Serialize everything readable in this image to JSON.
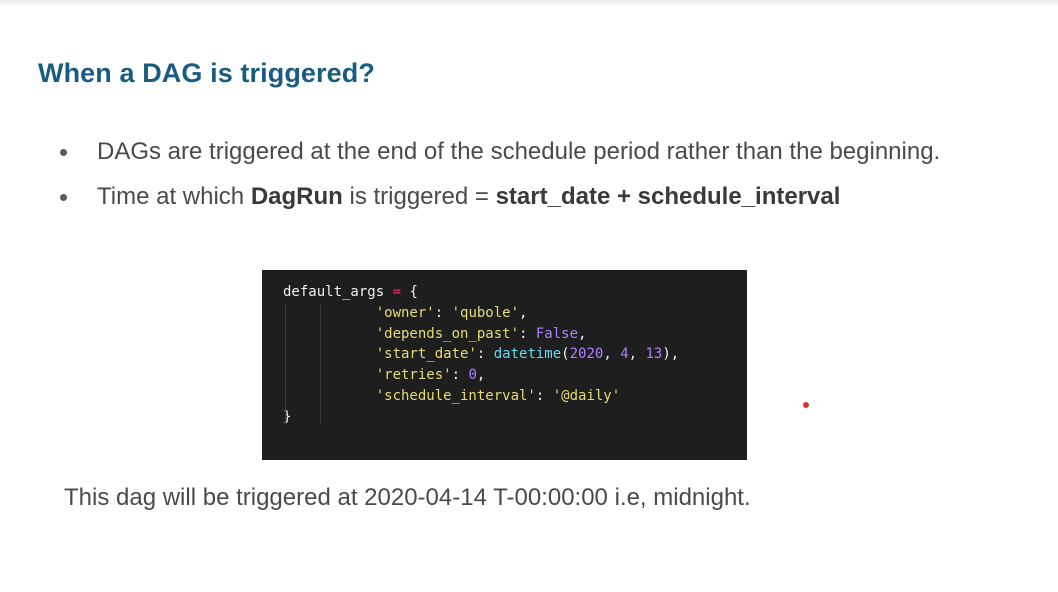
{
  "slide": {
    "title": "When a DAG is triggered?",
    "bullets": [
      {
        "text": "DAGs are triggered at the end of the schedule period rather than the beginning."
      },
      {
        "prefix": "Time at which ",
        "bold1": "DagRun",
        "middle": " is triggered = ",
        "bold2": "start_date + schedule_interval"
      }
    ],
    "code": {
      "lines": [
        [
          {
            "t": "default_args ",
            "c": "plain"
          },
          {
            "t": "=",
            "c": "op"
          },
          {
            "t": " {",
            "c": "plain"
          }
        ],
        [
          {
            "t": "           ",
            "c": "plain"
          },
          {
            "t": "'owner'",
            "c": "str"
          },
          {
            "t": ": ",
            "c": "plain"
          },
          {
            "t": "'qubole'",
            "c": "str"
          },
          {
            "t": ",",
            "c": "plain"
          }
        ],
        [
          {
            "t": "           ",
            "c": "plain"
          },
          {
            "t": "'depends_on_past'",
            "c": "str"
          },
          {
            "t": ": ",
            "c": "plain"
          },
          {
            "t": "False",
            "c": "bool"
          },
          {
            "t": ",",
            "c": "plain"
          }
        ],
        [
          {
            "t": "           ",
            "c": "plain"
          },
          {
            "t": "'start_date'",
            "c": "str"
          },
          {
            "t": ": ",
            "c": "plain"
          },
          {
            "t": "datetime",
            "c": "fn"
          },
          {
            "t": "(",
            "c": "plain"
          },
          {
            "t": "2020",
            "c": "num"
          },
          {
            "t": ", ",
            "c": "plain"
          },
          {
            "t": "4",
            "c": "num"
          },
          {
            "t": ", ",
            "c": "plain"
          },
          {
            "t": "13",
            "c": "num"
          },
          {
            "t": "),",
            "c": "plain"
          }
        ],
        [
          {
            "t": "           ",
            "c": "plain"
          },
          {
            "t": "'retries'",
            "c": "str"
          },
          {
            "t": ": ",
            "c": "plain"
          },
          {
            "t": "0",
            "c": "num"
          },
          {
            "t": ",",
            "c": "plain"
          }
        ],
        [
          {
            "t": "           ",
            "c": "plain"
          },
          {
            "t": "'schedule_interval'",
            "c": "str"
          },
          {
            "t": ": ",
            "c": "plain"
          },
          {
            "t": "'@daily'",
            "c": "str"
          }
        ],
        [
          {
            "t": "}",
            "c": "plain"
          }
        ]
      ]
    },
    "footer": "This dag will be triggered at 2020-04-14 T-00:00:00 i.e, midnight."
  },
  "colors": {
    "title": "#1a5c80",
    "body_text": "#4a4a4a",
    "code_background": "#1e1e1e",
    "code_string": "#e6db74",
    "code_keyword": "#ae81ff",
    "code_function": "#66d9ef",
    "code_operator": "#f92672",
    "pointer": "#e03030"
  }
}
